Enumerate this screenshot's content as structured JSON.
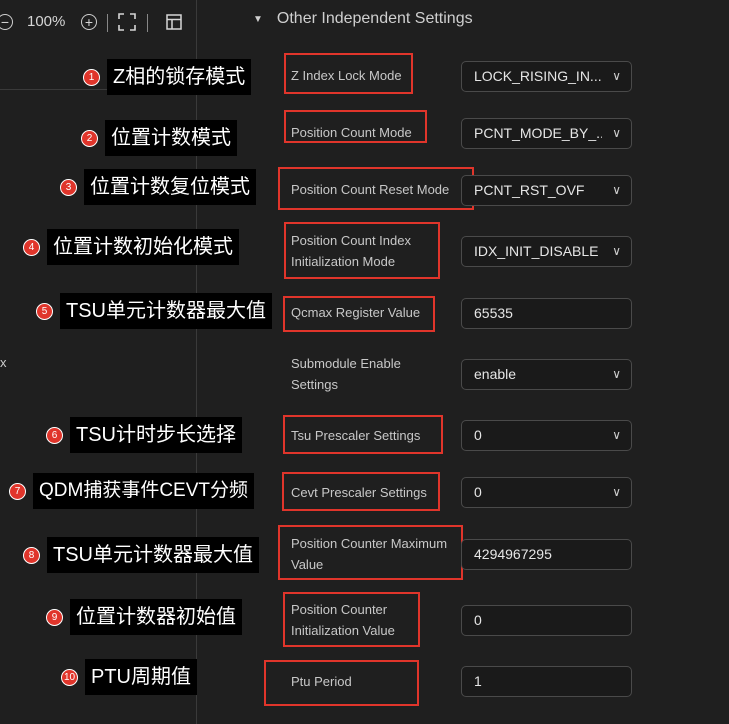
{
  "toolbar": {
    "zoom_out_icon": "zoom-out-icon",
    "zoom_level": "100%",
    "zoom_in_icon": "zoom-in-icon",
    "fit_icon": "fit-screen-icon",
    "panel_icon": "panel-icon"
  },
  "left_stub": "x",
  "section": {
    "title": "Other Independent Settings"
  },
  "settings": [
    {
      "label": "Z Index Lock Mode",
      "type": "select",
      "value": "LOCK_RISING_IN..."
    },
    {
      "label": "Position Count Mode",
      "type": "select",
      "value": "PCNT_MODE_BY_..."
    },
    {
      "label": "Position Count Reset Mode",
      "type": "select",
      "value": "PCNT_RST_OVF"
    },
    {
      "label": "Position Count Index Initialization Mode",
      "type": "select",
      "value": "IDX_INIT_DISABLE"
    },
    {
      "label": "Qcmax Register Value",
      "type": "input",
      "value": "65535"
    },
    {
      "label": "Submodule Enable Settings",
      "type": "select",
      "value": "enable"
    },
    {
      "label": "Tsu Prescaler Settings",
      "type": "select",
      "value": "0"
    },
    {
      "label": "Cevt Prescaler Settings",
      "type": "select",
      "value": "0"
    },
    {
      "label": "Position Counter Maximum Value",
      "type": "input",
      "value": "4294967295"
    },
    {
      "label": "Position Counter Initialization Value",
      "type": "input",
      "value": "0"
    },
    {
      "label": "Ptu Period",
      "type": "input",
      "value": "1"
    }
  ],
  "annotations": [
    {
      "num": "1",
      "text": "Z相的锁存模式"
    },
    {
      "num": "2",
      "text": "位置计数模式"
    },
    {
      "num": "3",
      "text": "位置计数复位模式"
    },
    {
      "num": "4",
      "text": "位置计数初始化模式"
    },
    {
      "num": "5",
      "text": "TSU单元计数器最大值"
    },
    {
      "num": "6",
      "text": "TSU计时步长选择"
    },
    {
      "num": "7",
      "text": "QDM捕获事件CEVT分频"
    },
    {
      "num": "8",
      "text": "TSU单元计数器最大值"
    },
    {
      "num": "9",
      "text": "位置计数器初始值"
    },
    {
      "num": "10",
      "text": "PTU周期值"
    }
  ],
  "colors": {
    "background": "#1f1f1f",
    "annotation_red": "#e0352b",
    "annotation_box": "#000000"
  }
}
